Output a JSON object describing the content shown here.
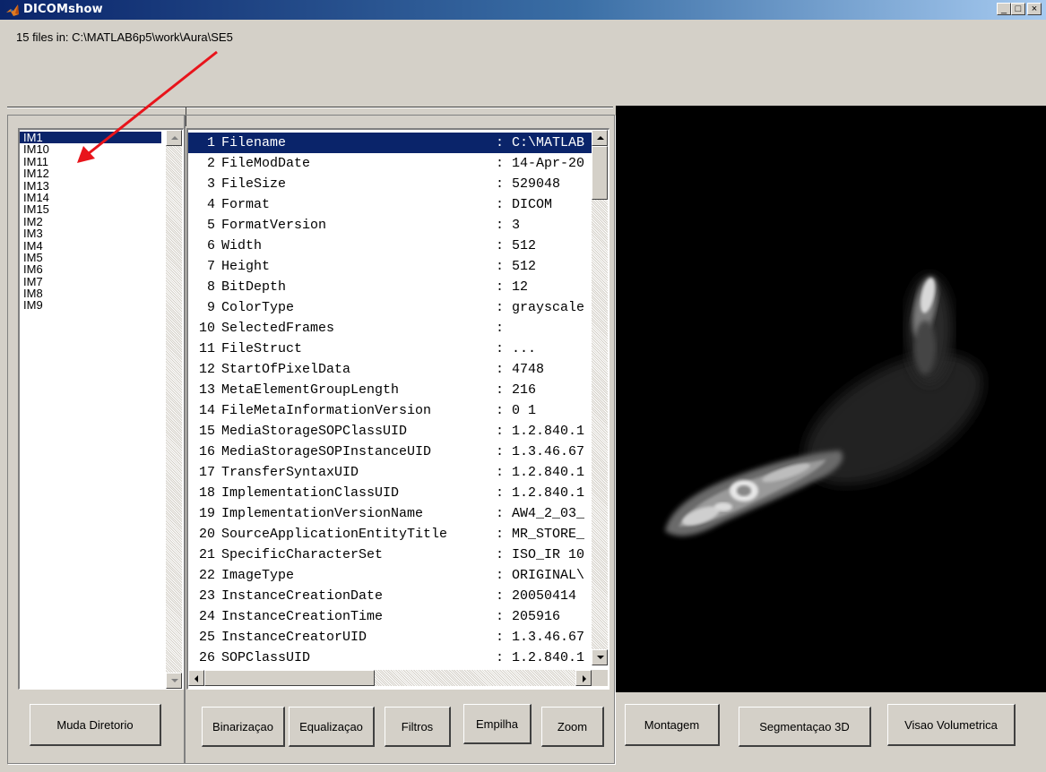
{
  "window": {
    "title": "DICOMshow",
    "min_label": "_",
    "max_label": "□",
    "close_label": "×"
  },
  "files_info": "15 files in: C:\\MATLAB6p5\\work\\Aura\\SE5",
  "file_list": {
    "items": [
      "IM1",
      "IM10",
      "IM11",
      "IM12",
      "IM13",
      "IM14",
      "IM15",
      "IM2",
      "IM3",
      "IM4",
      "IM5",
      "IM6",
      "IM7",
      "IM8",
      "IM9"
    ],
    "selected": "IM1"
  },
  "info_list": {
    "rows": [
      {
        "num": "1",
        "key": "Filename",
        "value": "C:\\MATLAB"
      },
      {
        "num": "2",
        "key": "FileModDate",
        "value": "14-Apr-20"
      },
      {
        "num": "3",
        "key": "FileSize",
        "value": "529048"
      },
      {
        "num": "4",
        "key": "Format",
        "value": "DICOM"
      },
      {
        "num": "5",
        "key": "FormatVersion",
        "value": "3"
      },
      {
        "num": "6",
        "key": "Width",
        "value": "512"
      },
      {
        "num": "7",
        "key": "Height",
        "value": "512"
      },
      {
        "num": "8",
        "key": "BitDepth",
        "value": "12"
      },
      {
        "num": "9",
        "key": "ColorType",
        "value": "grayscale"
      },
      {
        "num": "10",
        "key": "SelectedFrames",
        "value": ""
      },
      {
        "num": "11",
        "key": "FileStruct",
        "value": "..."
      },
      {
        "num": "12",
        "key": "StartOfPixelData",
        "value": "4748"
      },
      {
        "num": "13",
        "key": "MetaElementGroupLength",
        "value": "216"
      },
      {
        "num": "14",
        "key": "FileMetaInformationVersion",
        "value": "0  1"
      },
      {
        "num": "15",
        "key": "MediaStorageSOPClassUID",
        "value": "1.2.840.1"
      },
      {
        "num": "16",
        "key": "MediaStorageSOPInstanceUID",
        "value": "1.3.46.67"
      },
      {
        "num": "17",
        "key": "TransferSyntaxUID",
        "value": "1.2.840.1"
      },
      {
        "num": "18",
        "key": "ImplementationClassUID",
        "value": "1.2.840.1"
      },
      {
        "num": "19",
        "key": "ImplementationVersionName",
        "value": "AW4_2_03_"
      },
      {
        "num": "20",
        "key": "SourceApplicationEntityTitle",
        "value": "MR_STORE_"
      },
      {
        "num": "21",
        "key": "SpecificCharacterSet",
        "value": "ISO_IR 10"
      },
      {
        "num": "22",
        "key": "ImageType",
        "value": "ORIGINAL\\"
      },
      {
        "num": "23",
        "key": "InstanceCreationDate",
        "value": "20050414"
      },
      {
        "num": "24",
        "key": "InstanceCreationTime",
        "value": "205916"
      },
      {
        "num": "25",
        "key": "InstanceCreatorUID",
        "value": "1.3.46.67"
      },
      {
        "num": "26",
        "key": "SOPClassUID",
        "value": "1.2.840.1"
      }
    ],
    "selected_index": 0
  },
  "buttons": {
    "muda_diretorio": "Muda Diretorio",
    "binarizacao": "Binarizaçao",
    "equalizacao": "Equalizaçao",
    "filtros": "Filtros",
    "empilha": "Empilha",
    "zoom": "Zoom",
    "montagem": "Montagem",
    "segmentacao_3d": "Segmentaçao 3D",
    "visao_volumetrica": "Visao Volumetrica"
  },
  "colors": {
    "selection": "#0a246a",
    "face": "#d4d0c8",
    "annotation_arrow": "#e8141b",
    "image_background": "#000000"
  },
  "icons": {
    "app_icon": "matlab-logo-icon",
    "annotation": "red-arrow-icon"
  }
}
